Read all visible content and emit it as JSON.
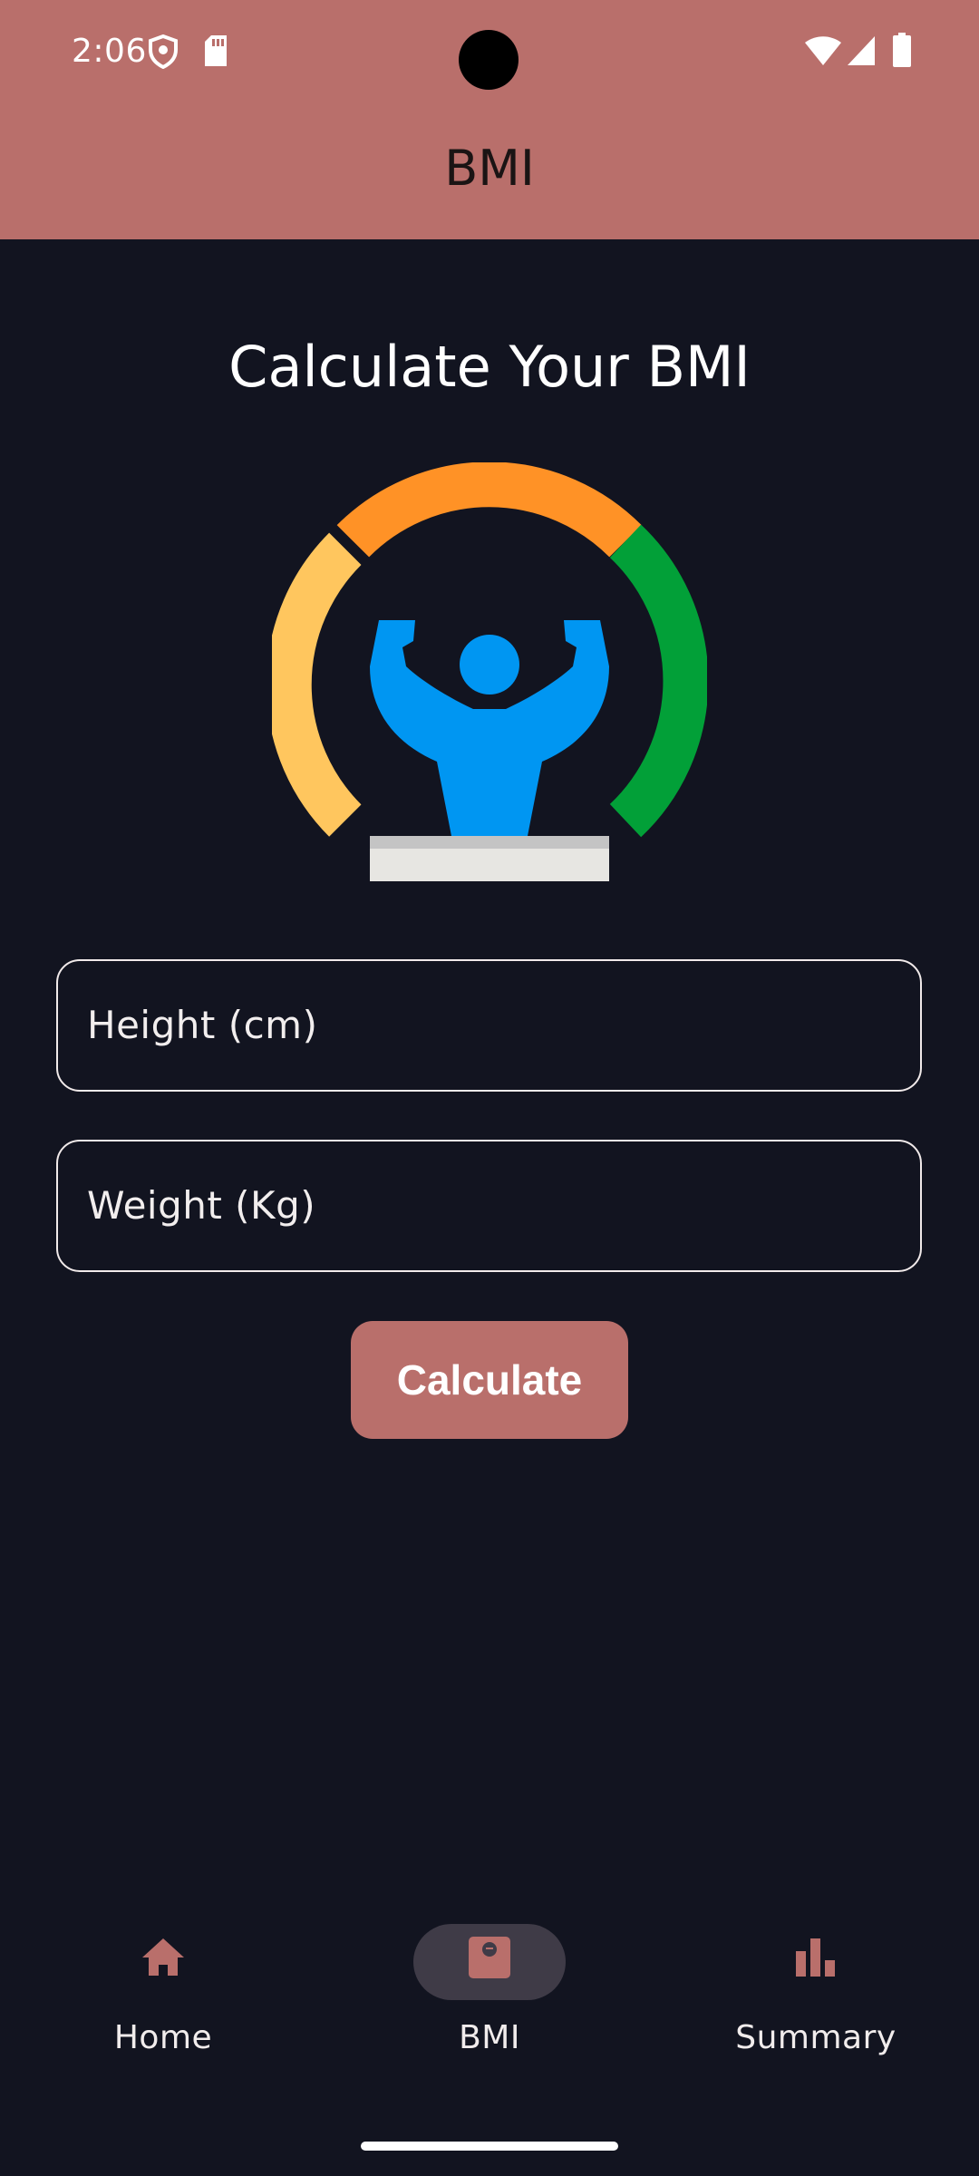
{
  "status_bar": {
    "time": "2:06",
    "icons": [
      "shield-icon",
      "sd-card-icon",
      "wifi-icon",
      "cellular-signal-icon",
      "battery-icon"
    ]
  },
  "app_bar": {
    "title": "BMI",
    "color": "#b96f6b"
  },
  "main": {
    "heading": "Calculate Your BMI",
    "illustration": "bmi-gauge-strongman-icon",
    "fields": [
      {
        "label": "Height (cm)",
        "value": ""
      },
      {
        "label": "Weight (Kg)",
        "value": ""
      }
    ],
    "calculate_label": "Calculate"
  },
  "bottom_nav": {
    "items": [
      {
        "label": "Home",
        "icon": "home-icon",
        "selected": false
      },
      {
        "label": "BMI",
        "icon": "scale-icon",
        "selected": true
      },
      {
        "label": "Summary",
        "icon": "bar-chart-icon",
        "selected": false
      }
    ]
  },
  "colors": {
    "accent": "#b96f6b",
    "background": "#121420",
    "selected_pill": "#3f3b47",
    "gauge_yellow": "#ffc65e",
    "gauge_orange": "#ff9226",
    "gauge_green": "#02a038",
    "figure_blue": "#0096f2"
  }
}
